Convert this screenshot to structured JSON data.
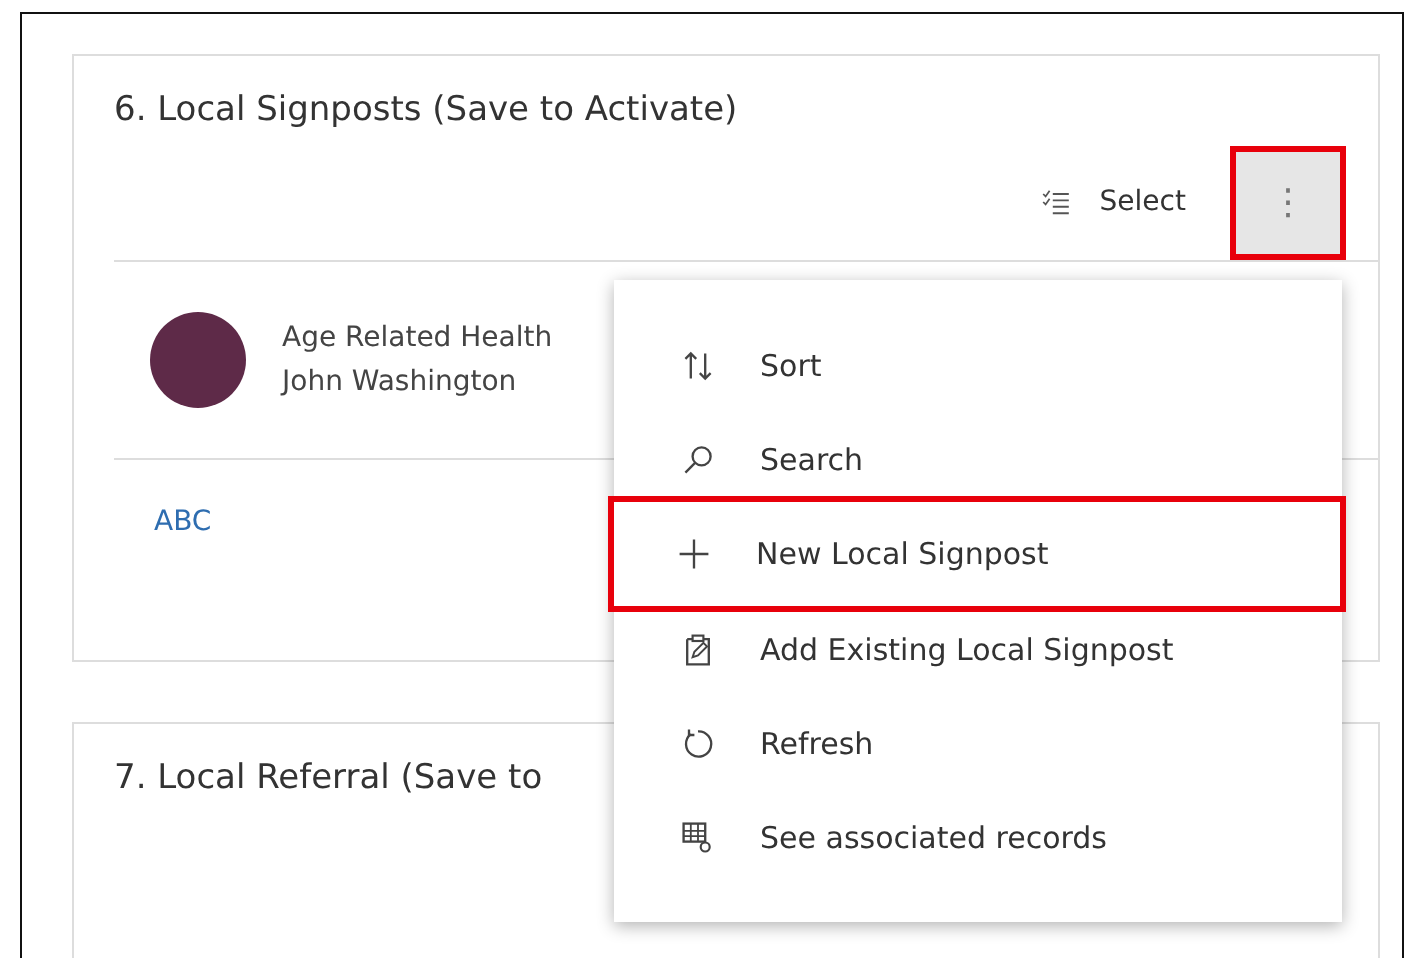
{
  "sections": [
    {
      "title": "6. Local Signposts (Save to Activate)",
      "toolbar": {
        "select_label": "Select",
        "more_button": {
          "label": "⋮",
          "highlighted": true
        }
      },
      "records": [
        {
          "color": "#5e2a48",
          "line_1": "Age Related Health",
          "line_2": "John Washington"
        }
      ],
      "link": "ABC"
    },
    {
      "title": "7. Local Referral (Save to"
    }
  ],
  "menu": {
    "items": [
      {
        "kind": "sort",
        "label": "Sort",
        "highlighted": false
      },
      {
        "kind": "search",
        "label": "Search",
        "highlighted": false
      },
      {
        "kind": "new",
        "label": "New Local Signpost",
        "highlighted": true
      },
      {
        "kind": "add",
        "label": "Add Existing Local Signpost",
        "highlighted": false
      },
      {
        "kind": "refresh",
        "label": "Refresh",
        "highlighted": false
      },
      {
        "kind": "associated",
        "label": "See associated records",
        "highlighted": false
      }
    ]
  }
}
